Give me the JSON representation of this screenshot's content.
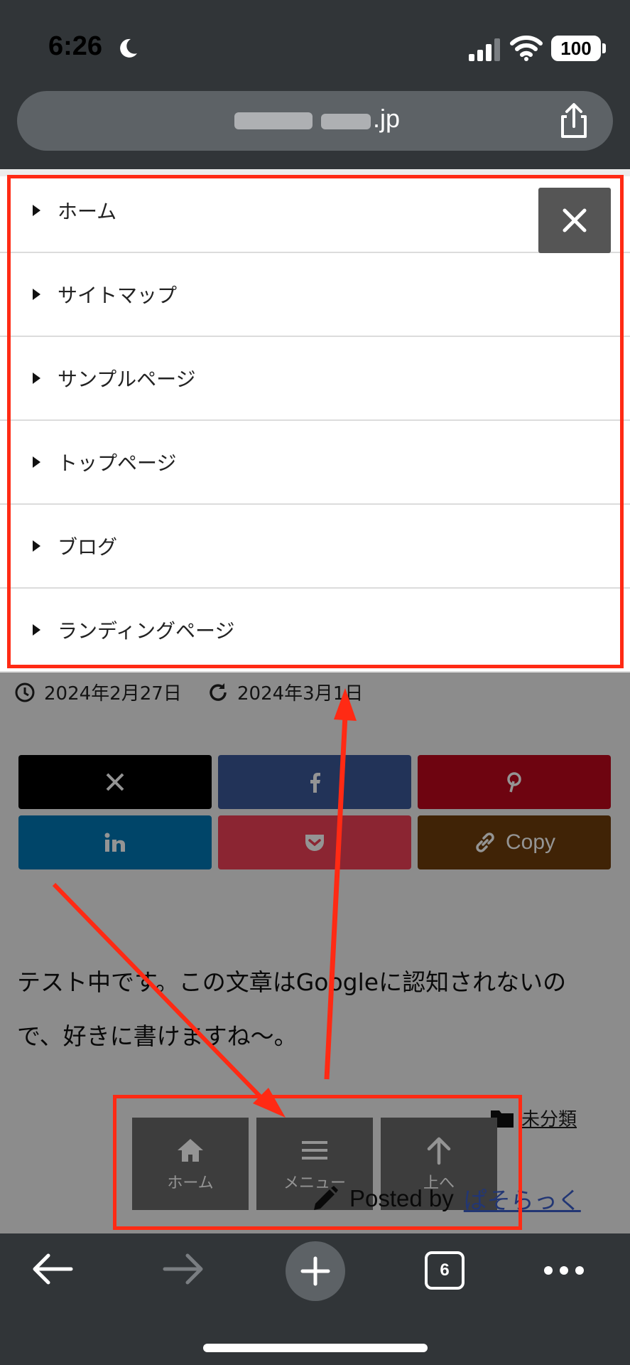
{
  "status_bar": {
    "time": "6:26",
    "battery": "100"
  },
  "browser": {
    "url_suffix": ".jp",
    "tab_count": "6"
  },
  "menu": {
    "items": [
      {
        "label": "ホーム"
      },
      {
        "label": "サイトマップ"
      },
      {
        "label": "サンプルページ"
      },
      {
        "label": "トップページ"
      },
      {
        "label": "ブログ"
      },
      {
        "label": "ランディングページ"
      }
    ]
  },
  "post": {
    "published": "2024年2月27日",
    "updated": "2024年3月1日",
    "body_line1": "テスト中です。この文章はGoogleに認知されないの",
    "body_line2": "で、好きに書けますね〜。",
    "category": "未分類",
    "posted_by_prefix": "Posted by",
    "author": "ぱそらっく"
  },
  "share": {
    "copy_label": "Copy"
  },
  "footer_buttons": [
    {
      "label": "ホーム"
    },
    {
      "label": "メニュー"
    },
    {
      "label": "上へ"
    }
  ],
  "colors": {
    "annotation_red": "#ff2a14",
    "x": "#000000",
    "facebook": "#3b5998",
    "pinterest": "#bd081c",
    "linkedin": "#0077b5",
    "pocket": "#ef4056",
    "copy": "#6e3d0c"
  }
}
